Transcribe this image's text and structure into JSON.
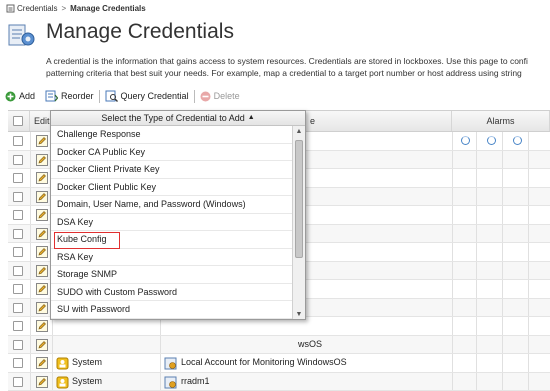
{
  "breadcrumb": {
    "parent": "Credentials",
    "separator": ">",
    "current": "Manage Credentials"
  },
  "page": {
    "title": "Manage Credentials",
    "description_line1": "A credential is the information that gains access to system resources. Credentials are stored in lockboxes. Use this page to confi",
    "description_line2": "patterning criteria that best suit your needs. For example, map a credential to a target port number or host address using string"
  },
  "toolbar": {
    "add": "Add",
    "reorder": "Reorder",
    "query": "Query Credential",
    "delete": "Delete"
  },
  "grid": {
    "columns": {
      "edit": "Edit",
      "name_suffix": "e",
      "alarms": "Alarms"
    },
    "rows": [
      {
        "owner": "",
        "name": "",
        "alarms": true
      },
      {
        "owner": "",
        "name": "",
        "alarms": false
      },
      {
        "owner": "",
        "name": "",
        "alarms": false
      },
      {
        "owner": "",
        "name": "",
        "alarms": false
      },
      {
        "owner": "",
        "name": "",
        "alarms": false
      },
      {
        "owner": "",
        "name": "",
        "alarms": false
      },
      {
        "owner": "",
        "name": "",
        "alarms": false
      },
      {
        "owner": "",
        "name": "",
        "alarms": false
      },
      {
        "owner": "",
        "name": "",
        "alarms": false
      },
      {
        "owner": "",
        "name": "",
        "alarms": false
      },
      {
        "owner": "",
        "name": "",
        "alarms": false
      },
      {
        "owner": "",
        "name": "wsOS",
        "alarms": false
      },
      {
        "owner": "System",
        "name": "Local Account for Monitoring WindowsOS",
        "alarms": false
      },
      {
        "owner": "System",
        "name": "rradm1",
        "alarms": false
      }
    ]
  },
  "dropdown": {
    "header": "Select the Type of Credential to Add",
    "items": [
      "Challenge Response",
      "Docker CA Public Key",
      "Docker Client Private Key",
      "Docker Client Public Key",
      "Domain, User Name, and Password (Windows)",
      "DSA Key",
      "Kube Config",
      "RSA Key",
      "Storage SNMP",
      "SUDO with Custom Password",
      "SU with Password"
    ],
    "highlighted": "Kube Config"
  },
  "colors": {
    "accent": "#4a86c8",
    "highlight_border": "#e03030",
    "add_green": "#3a9a3a",
    "delete_red": "#cc4444"
  }
}
